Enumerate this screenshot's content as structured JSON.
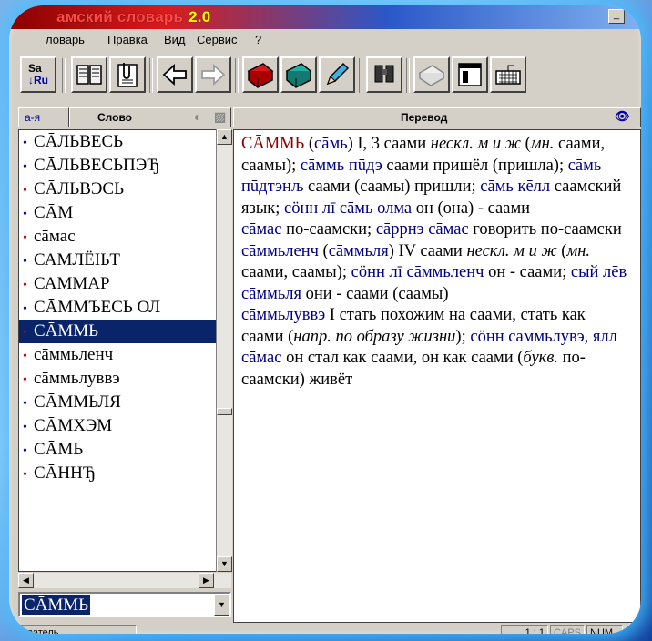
{
  "window": {
    "title": "амский словарь",
    "version": "2.0",
    "minimize_glyph": "_"
  },
  "menu": [
    "ловарь",
    "Правка",
    "Вид",
    "Сервис",
    "?"
  ],
  "toolbar": {
    "sa_ru_top": "Sa",
    "sa_ru_bottom": "↓Ru",
    "buttons": [
      "dictionary-book-icon",
      "clipboard-icon",
      "back-arrow-icon",
      "forward-arrow-icon",
      "red-book-icon",
      "teal-book-icon",
      "pencil-icon",
      "binoculars-icon",
      "stack-icon",
      "window-icon",
      "keyboard-icon"
    ]
  },
  "left_header": {
    "az_label": "а-я",
    "word_label": "Слово"
  },
  "word_list": [
    {
      "dot_color": "#0000a0",
      "text": "СĀЛЬВЕСЬ"
    },
    {
      "dot_color": "#0000a0",
      "text": "СĀЛЬВЕСЬПЭЂ"
    },
    {
      "dot_color": "#c00000",
      "text": "СĀЛЬВЭСЬ"
    },
    {
      "dot_color": "#0000a0",
      "text": "СĀМ"
    },
    {
      "dot_color": "#c00000",
      "text": "сāмас"
    },
    {
      "dot_color": "#0000a0",
      "text": "САМЛЁЊТ"
    },
    {
      "dot_color": "#c00000",
      "text": "САММАР"
    },
    {
      "dot_color": "#0000a0",
      "text": "СĀММЪЕСЬ ОЛ"
    },
    {
      "dot_color": "#c00000",
      "text": "СĀММЬ",
      "selected": true
    },
    {
      "dot_color": "#c00000",
      "text": "сāммьленч"
    },
    {
      "dot_color": "#c00000",
      "text": "сāммьлуввэ"
    },
    {
      "dot_color": "#0000a0",
      "text": "СĀММЬЛЯ"
    },
    {
      "dot_color": "#0000a0",
      "text": "СĀМХЭМ"
    },
    {
      "dot_color": "#0000a0",
      "text": "СĀМЬ"
    },
    {
      "dot_color": "#c00000",
      "text": "СĀННЂ"
    }
  ],
  "search_value": "СĀММЬ",
  "right_header": {
    "translation_label": "Перевод"
  },
  "article": {
    "p1": {
      "hw": "СĀММЬ",
      "t1": " (",
      "b1": "сāмь",
      "t2": ") I, 3 саами ",
      "i1": "нескл. м и ж",
      "t3": " (",
      "i2": "мн.",
      "t4": " саами, саамы); ",
      "b2": "сāммь пūдэ",
      "t5": " саами пришёл (пришла); ",
      "b3": "сāмь пūдтэнљ",
      "t6": " саами (саамы) пришли; ",
      "b4": "сāмь кēлл",
      "t7": " саамский язык; ",
      "b5": "сӧнн лī сāмь олма",
      "t8": " он (она) - саами"
    },
    "p2": {
      "b1": "сāмас",
      "t1": " по-саамски; ",
      "b2": "сāррнэ сāмас",
      "t2": " говорить по-саамски"
    },
    "p3": {
      "b1": "сāммьленч",
      "t1": " (",
      "b2": "сāммьля",
      "t2": ") IV саами ",
      "i1": "нескл. м и ж",
      "t3": " (",
      "i2": "мн.",
      "t4": " саами, саамы); ",
      "b3": "сӧнн лī сāммьленч",
      "t5": " он - саами; ",
      "b4": "сый лēв сāммьля",
      "t6": " они - саами (саамы)"
    },
    "p4": {
      "b1": "сāммьлуввэ",
      "t1": " I стать похожим на саами, стать как саами (",
      "i1": "напр. по образу жизни",
      "t2": "); ",
      "b2": "сӧнн сāммьлувэ, ялл сāмас",
      "t3": " он стал как саами, он как саами (",
      "i2": "букв.",
      "t4": " по-саамски) живёт"
    }
  },
  "status": {
    "left": "ователь",
    "pos": "1 :   1",
    "caps": "CAPS",
    "num": "NUM"
  },
  "colors": {
    "headword": "#8b0000",
    "blue_text": "#000080",
    "selection": "#0a246a",
    "glow": "#46beff"
  }
}
